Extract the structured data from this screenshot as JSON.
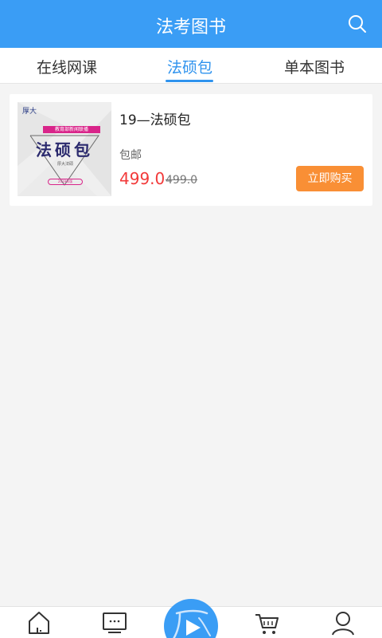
{
  "header": {
    "title": "法考图书"
  },
  "tabs": [
    {
      "label": "在线网课",
      "active": false
    },
    {
      "label": "法硕包",
      "active": true
    },
    {
      "label": "单本图书",
      "active": false
    }
  ],
  "products": [
    {
      "title": "19—法硕包",
      "shipping": "包邮",
      "price": "499.0",
      "original_price": "499.0",
      "buy_label": "立即购买",
      "image": {
        "logo": "厚大",
        "banner": "教育部新闻联播",
        "big_text": "法硕包",
        "sub_text": "厚大法硕",
        "tag": "2019年版"
      }
    }
  ],
  "bottom_nav": [
    {
      "icon": "home-icon"
    },
    {
      "icon": "monitor-icon"
    },
    {
      "icon": "play-logo-icon",
      "label": "厚大"
    },
    {
      "icon": "cart-icon"
    },
    {
      "icon": "user-icon"
    }
  ],
  "colors": {
    "primary": "#3a9df5",
    "active_tab": "#2f93ee",
    "price": "#f23a3a",
    "buy_button": "#f98f35"
  }
}
